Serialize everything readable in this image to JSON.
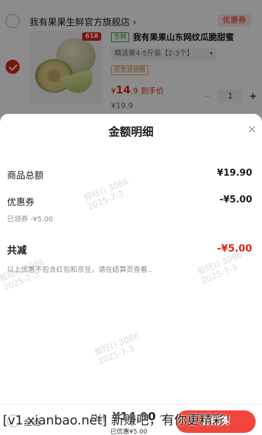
{
  "cart": {
    "shop_name": "我有果果生鲜官方旗舰店",
    "shop_chevron": "›",
    "coupon_label": "优惠券",
    "badge_618": "618",
    "fresh_tag": "生鲜",
    "product_title": "我有果果山东网纹瓜脆甜蜜",
    "spec": "精选果4-5斤装【2-3个】",
    "spec_dropdown": "▾",
    "promo_tag": "买贵双倍赔",
    "price_symbol": "¥",
    "price_main": "14",
    "price_decimal": ".9",
    "price_label": "到手价",
    "original_price": "¥19.9",
    "qty_minus": "−",
    "quantity": "1",
    "qty_plus": "+"
  },
  "sheet": {
    "title": "金额明细",
    "close_icon": "×",
    "rows": {
      "goods_total_label": "商品总额",
      "goods_total_value": "¥19.90",
      "coupon_label": "优惠券",
      "coupon_value": "-¥5.00",
      "coupon_sub": "已领券 -¥5.00",
      "total_discount_label": "共减",
      "total_discount_value": "-¥5.00",
      "note": "以上优惠不包含红包和京豆，请在结算页查看.."
    }
  },
  "watermark": {
    "line1": "叙旺() 3086",
    "line2": "2025-7-3"
  },
  "bottom_bar": {
    "select_all": "全选",
    "total_label": "总计",
    "total_value": "¥14.90",
    "discount_text": "已优惠¥5.00",
    "chevron": "^",
    "checkout_label": "去结算"
  },
  "overlay_banner": "[v1.xianbao.net] 新赚吧，有你更精彩！"
}
